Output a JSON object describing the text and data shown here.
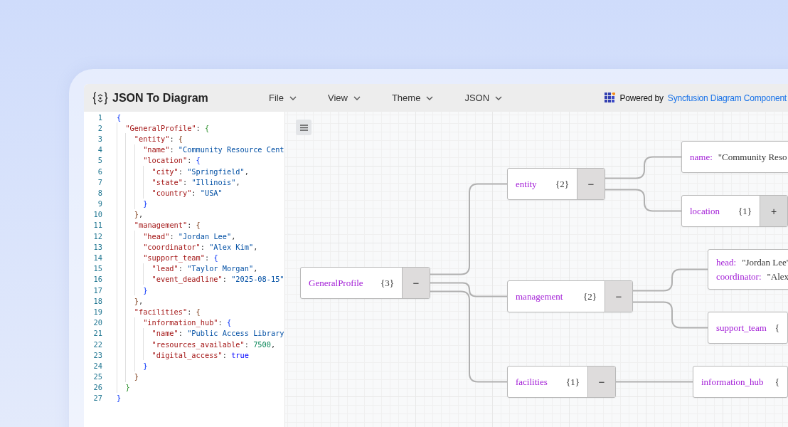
{
  "app": {
    "title": "JSON To Diagram",
    "menus": [
      {
        "label": "File"
      },
      {
        "label": "View"
      },
      {
        "label": "Theme"
      },
      {
        "label": "JSON"
      }
    ],
    "powered_by": {
      "text": "Powered by",
      "link": "Syncfusion Diagram Component"
    }
  },
  "editor": {
    "lines": [
      {
        "number": "1",
        "tokens": [
          {
            "kind": "brace",
            "text": "{"
          }
        ]
      },
      {
        "number": "2",
        "tokens": [
          {
            "kind": "key",
            "text": "\"GeneralProfile\""
          },
          {
            "kind": "punct",
            "text": ": "
          },
          {
            "kind": "brace",
            "text": "{"
          }
        ]
      },
      {
        "number": "3",
        "tokens": [
          {
            "kind": "key",
            "text": "\"entity\""
          },
          {
            "kind": "punct",
            "text": ": "
          },
          {
            "kind": "brace",
            "text": "{"
          }
        ]
      },
      {
        "number": "4",
        "tokens": [
          {
            "kind": "key",
            "text": "\"name\""
          },
          {
            "kind": "punct",
            "text": ": "
          },
          {
            "kind": "string",
            "text": "\"Community Resource Cent"
          }
        ]
      },
      {
        "number": "5",
        "tokens": [
          {
            "kind": "key",
            "text": "\"location\""
          },
          {
            "kind": "punct",
            "text": ": "
          },
          {
            "kind": "brace",
            "text": "{"
          }
        ]
      },
      {
        "number": "6",
        "tokens": [
          {
            "kind": "key",
            "text": "\"city\""
          },
          {
            "kind": "punct",
            "text": ": "
          },
          {
            "kind": "string",
            "text": "\"Springfield\""
          },
          {
            "kind": "punct",
            "text": ","
          }
        ]
      },
      {
        "number": "7",
        "tokens": [
          {
            "kind": "key",
            "text": "\"state\""
          },
          {
            "kind": "punct",
            "text": ": "
          },
          {
            "kind": "string",
            "text": "\"Illinois\""
          },
          {
            "kind": "punct",
            "text": ","
          }
        ]
      },
      {
        "number": "8",
        "tokens": [
          {
            "kind": "key",
            "text": "\"country\""
          },
          {
            "kind": "punct",
            "text": ": "
          },
          {
            "kind": "string",
            "text": "\"USA\""
          }
        ]
      },
      {
        "number": "9",
        "tokens": [
          {
            "kind": "brace",
            "text": "}"
          }
        ]
      },
      {
        "number": "10",
        "tokens": [
          {
            "kind": "brace",
            "text": "}"
          },
          {
            "kind": "punct",
            "text": ","
          }
        ]
      },
      {
        "number": "11",
        "tokens": [
          {
            "kind": "key",
            "text": "\"management\""
          },
          {
            "kind": "punct",
            "text": ": "
          },
          {
            "kind": "brace",
            "text": "{"
          }
        ]
      },
      {
        "number": "12",
        "tokens": [
          {
            "kind": "key",
            "text": "\"head\""
          },
          {
            "kind": "punct",
            "text": ": "
          },
          {
            "kind": "string",
            "text": "\"Jordan Lee\""
          },
          {
            "kind": "punct",
            "text": ","
          }
        ]
      },
      {
        "number": "13",
        "tokens": [
          {
            "kind": "key",
            "text": "\"coordinator\""
          },
          {
            "kind": "punct",
            "text": ": "
          },
          {
            "kind": "string",
            "text": "\"Alex Kim\""
          },
          {
            "kind": "punct",
            "text": ","
          }
        ]
      },
      {
        "number": "14",
        "tokens": [
          {
            "kind": "key",
            "text": "\"support_team\""
          },
          {
            "kind": "punct",
            "text": ": "
          },
          {
            "kind": "brace",
            "text": "{"
          }
        ]
      },
      {
        "number": "15",
        "tokens": [
          {
            "kind": "key",
            "text": "\"lead\""
          },
          {
            "kind": "punct",
            "text": ": "
          },
          {
            "kind": "string",
            "text": "\"Taylor Morgan\""
          },
          {
            "kind": "punct",
            "text": ","
          }
        ]
      },
      {
        "number": "16",
        "tokens": [
          {
            "kind": "key",
            "text": "\"event_deadline\""
          },
          {
            "kind": "punct",
            "text": ": "
          },
          {
            "kind": "string",
            "text": "\"2025-08-15\""
          }
        ]
      },
      {
        "number": "17",
        "tokens": [
          {
            "kind": "brace",
            "text": "}"
          }
        ]
      },
      {
        "number": "18",
        "tokens": [
          {
            "kind": "brace",
            "text": "}"
          },
          {
            "kind": "punct",
            "text": ","
          }
        ]
      },
      {
        "number": "19",
        "tokens": [
          {
            "kind": "key",
            "text": "\"facilities\""
          },
          {
            "kind": "punct",
            "text": ": "
          },
          {
            "kind": "brace",
            "text": "{"
          }
        ]
      },
      {
        "number": "20",
        "tokens": [
          {
            "kind": "key",
            "text": "\"information_hub\""
          },
          {
            "kind": "punct",
            "text": ": "
          },
          {
            "kind": "brace",
            "text": "{"
          }
        ]
      },
      {
        "number": "21",
        "tokens": [
          {
            "kind": "key",
            "text": "\"name\""
          },
          {
            "kind": "punct",
            "text": ": "
          },
          {
            "kind": "string",
            "text": "\"Public Access Library"
          }
        ]
      },
      {
        "number": "22",
        "tokens": [
          {
            "kind": "key",
            "text": "\"resources_available\""
          },
          {
            "kind": "punct",
            "text": ": "
          },
          {
            "kind": "number",
            "text": "7500"
          },
          {
            "kind": "punct",
            "text": ","
          }
        ]
      },
      {
        "number": "23",
        "tokens": [
          {
            "kind": "key",
            "text": "\"digital_access\""
          },
          {
            "kind": "punct",
            "text": ": "
          },
          {
            "kind": "boolean",
            "text": "true"
          }
        ]
      },
      {
        "number": "24",
        "tokens": [
          {
            "kind": "brace",
            "text": "}"
          }
        ]
      },
      {
        "number": "25",
        "tokens": [
          {
            "kind": "brace",
            "text": "}"
          }
        ]
      },
      {
        "number": "26",
        "tokens": [
          {
            "kind": "brace",
            "text": "}"
          }
        ]
      },
      {
        "number": "27",
        "tokens": [
          {
            "kind": "brace",
            "text": "}"
          }
        ]
      }
    ]
  },
  "diagram": {
    "root": {
      "kind": "object",
      "label": "GeneralProfile",
      "count": "{3}",
      "toggle": "−",
      "expanded": true,
      "children": [
        {
          "kind": "object",
          "label": "entity",
          "count": "{2}",
          "toggle": "−",
          "expanded": true,
          "children": [
            {
              "kind": "leaf",
              "fields": [
                {
                  "key": "name:",
                  "value": "\"Community Reso"
                }
              ]
            },
            {
              "kind": "object",
              "label": "location",
              "count": "{1}",
              "toggle": "+",
              "expanded": false
            }
          ]
        },
        {
          "kind": "object",
          "label": "management",
          "count": "{2}",
          "toggle": "−",
          "expanded": true,
          "children": [
            {
              "kind": "leaf",
              "fields": [
                {
                  "key": "head:",
                  "value": "\"Jordan Lee'"
                },
                {
                  "key": "coordinator:",
                  "value": "\"Alex"
                }
              ]
            },
            {
              "kind": "object",
              "label": "support_team",
              "count": "{"
            }
          ]
        },
        {
          "kind": "object",
          "label": "facilities",
          "count": "{1}",
          "toggle": "−",
          "expanded": true,
          "children": [
            {
              "kind": "object",
              "label": "information_hub",
              "count": "{"
            }
          ]
        }
      ]
    }
  }
}
